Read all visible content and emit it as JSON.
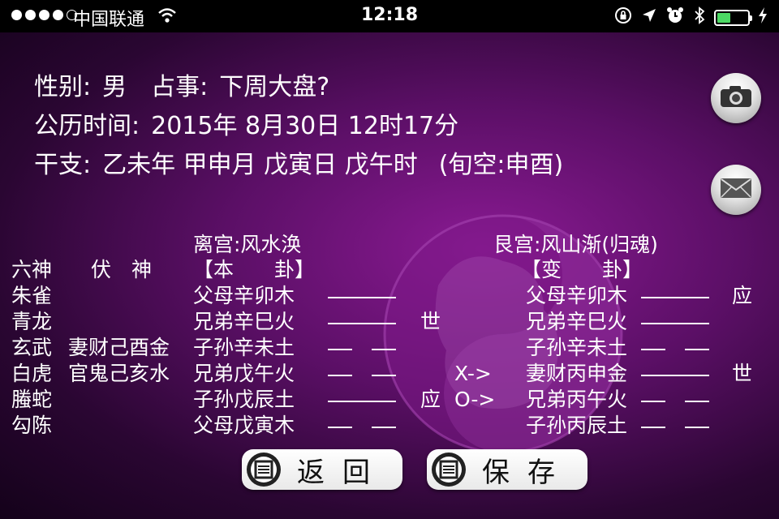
{
  "status_bar": {
    "carrier": "中国联通",
    "time": "12:18"
  },
  "header": {
    "gender_label": "性别:",
    "gender_value": "男",
    "topic_label": "占事:",
    "topic_value": "下周大盘?",
    "solar_label": "公历时间:",
    "solar_value": "2015年 8月30日 12时17分",
    "ganzhi_label": "干支:",
    "ganzhi_value": "乙未年 甲申月 戊寅日 戊午时",
    "xunkong": "(旬空:申酉)"
  },
  "hexagram": {
    "original_palace": "离宫:风水涣",
    "changed_palace": "艮宫:风山渐(归魂)",
    "col_six_gods": "六神",
    "col_hidden": "伏　神",
    "col_original": "【本　　卦】",
    "col_changed": "【变　　卦】",
    "rows": [
      {
        "god": "朱雀",
        "hidden": "",
        "original": "父母辛卯木",
        "orig_line": "yang",
        "shi_ying": "",
        "move": "",
        "changed": "父母辛卯木",
        "changed_line": "yang",
        "changed_mark": "应"
      },
      {
        "god": "青龙",
        "hidden": "",
        "original": "兄弟辛巳火",
        "orig_line": "yang",
        "shi_ying": "世",
        "move": "",
        "changed": "兄弟辛巳火",
        "changed_line": "yang",
        "changed_mark": ""
      },
      {
        "god": "玄武",
        "hidden": "妻财己酉金",
        "original": "子孙辛未土",
        "orig_line": "yin",
        "shi_ying": "",
        "move": "",
        "changed": "子孙辛未土",
        "changed_line": "yin",
        "changed_mark": ""
      },
      {
        "god": "白虎",
        "hidden": "官鬼己亥水",
        "original": "兄弟戊午火",
        "orig_line": "yin",
        "shi_ying": "",
        "move": "X->",
        "changed": "妻财丙申金",
        "changed_line": "yang",
        "changed_mark": "世"
      },
      {
        "god": "螣蛇",
        "hidden": "",
        "original": "子孙戊辰土",
        "orig_line": "yang",
        "shi_ying": "应",
        "move": "O->",
        "changed": "兄弟丙午火",
        "changed_line": "yin",
        "changed_mark": ""
      },
      {
        "god": "勾陈",
        "hidden": "",
        "original": "父母戊寅木",
        "orig_line": "yin",
        "shi_ying": "",
        "move": "",
        "changed": "子孙丙辰土",
        "changed_line": "yin",
        "changed_mark": ""
      }
    ]
  },
  "buttons": {
    "back_label": "返回",
    "save_label": "保存"
  },
  "icons": {
    "camera": "camera-icon",
    "mail": "mail-icon"
  },
  "colors": {
    "background": "#5b0f66",
    "battery": "#4cd964"
  }
}
